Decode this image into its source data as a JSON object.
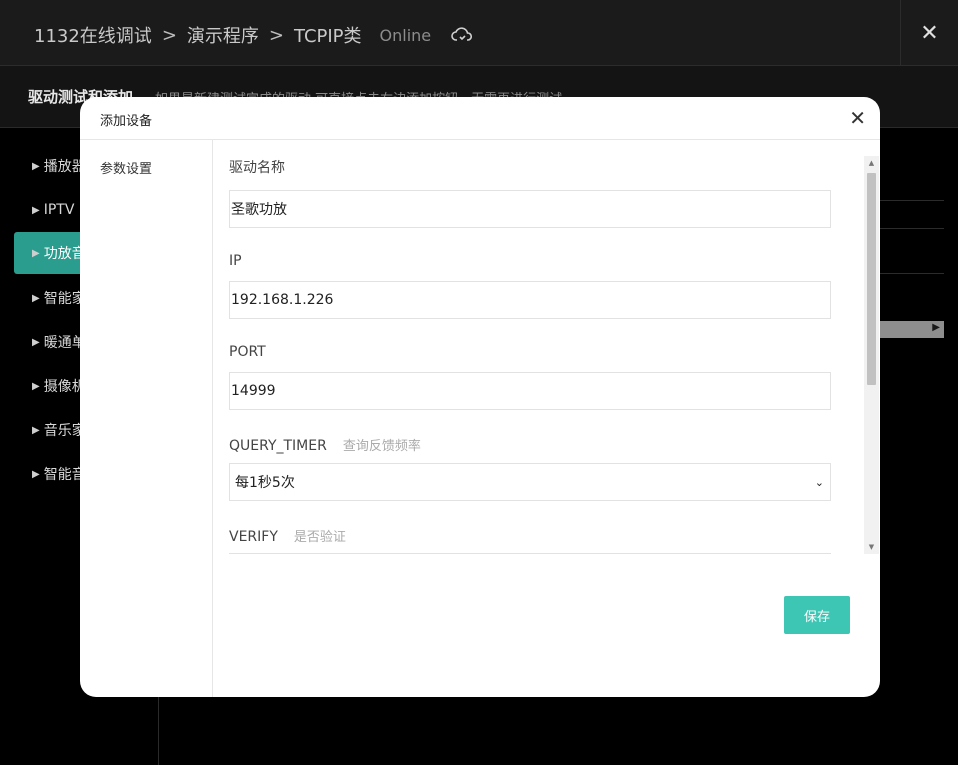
{
  "breadcrumb": {
    "items": [
      "1132在线调试",
      "演示程序",
      "TCPIP类"
    ],
    "separator": ">",
    "status": "Online"
  },
  "section": {
    "title": "驱动测试和添加",
    "hint": "如果是新建测试完成的驱动 可直接点击右边添加按钮，无需再进行测试"
  },
  "sidebar": {
    "items": [
      {
        "label": "播放器"
      },
      {
        "label": "IPTV"
      },
      {
        "label": "功放音"
      },
      {
        "label": "智能家"
      },
      {
        "label": "暖通单"
      },
      {
        "label": "摄像机"
      },
      {
        "label": "音乐家"
      },
      {
        "label": "智能音"
      }
    ],
    "active_index": 2
  },
  "modal": {
    "title": "添加设备",
    "tab": "参数设置",
    "fields": [
      {
        "label": "驱动名称",
        "value": "圣歌功放"
      },
      {
        "label": "IP",
        "value": "192.168.1.226"
      },
      {
        "label": "PORT",
        "value": "14999"
      },
      {
        "label": "QUERY_TIMER",
        "sub": "查询反馈频率",
        "value": "每1秒5次"
      },
      {
        "label": "VERIFY",
        "sub": "是否验证"
      }
    ],
    "save_label": "保存"
  },
  "colors": {
    "accent": "#3ec6b4",
    "active_nav": "#2a9d8f",
    "background": "#000000"
  },
  "icons": {
    "cloud": "cloud-sync-icon",
    "close": "close-icon",
    "nav_arrow": "triangle-right-icon",
    "select": "chevron-down-icon"
  }
}
